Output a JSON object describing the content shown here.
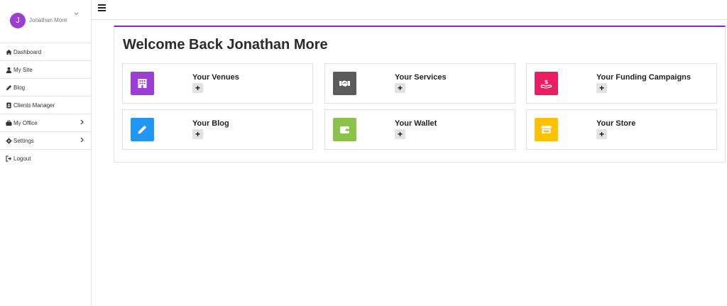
{
  "user": {
    "initial": "J",
    "name": "Jonathan More"
  },
  "sidebar": {
    "items": [
      {
        "label": "Dashboard",
        "icon": "home-icon"
      },
      {
        "label": "My Site",
        "icon": "user-icon"
      },
      {
        "label": "Blog",
        "icon": "pencil-icon"
      },
      {
        "label": "Clients Manager",
        "icon": "address-book-icon"
      },
      {
        "label": "My Office",
        "icon": "briefcase-icon"
      },
      {
        "label": "Settings",
        "icon": "gear-icon"
      },
      {
        "label": "Logout",
        "icon": "sign-out-icon"
      }
    ]
  },
  "main": {
    "welcome": "Welcome Back Jonathan More",
    "cards": [
      {
        "title": "Your Venues",
        "icon": "building-icon",
        "color": "#9b3fd3",
        "action": "+"
      },
      {
        "title": "Your Services",
        "icon": "handshake-icon",
        "color": "#5b5b5b",
        "action": "+"
      },
      {
        "title": "Your Funding Campaigns",
        "icon": "donate-icon",
        "color": "#e91e63",
        "action": "+"
      },
      {
        "title": "Your Blog",
        "icon": "pencil-icon",
        "color": "#2196f3",
        "action": "+"
      },
      {
        "title": "Your Wallet",
        "icon": "wallet-icon",
        "color": "#8bc34a",
        "action": "+"
      },
      {
        "title": "Your Store",
        "icon": "store-icon",
        "color": "#ffc107",
        "action": "+"
      }
    ]
  },
  "colors": {
    "accent": "#8a23c9"
  }
}
